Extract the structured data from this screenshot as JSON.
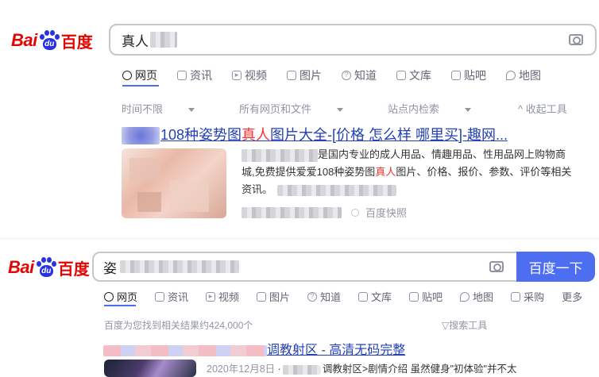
{
  "brand": {
    "bai": "Bai",
    "du": "du",
    "cn": "百度"
  },
  "result1": {
    "query_visible": "真人",
    "tabs": [
      {
        "label": "网页",
        "icon": "search-icon",
        "active": true
      },
      {
        "label": "资讯",
        "icon": "news-icon"
      },
      {
        "label": "视频",
        "icon": "video-icon"
      },
      {
        "label": "图片",
        "icon": "image-icon"
      },
      {
        "label": "知道",
        "icon": "question-icon"
      },
      {
        "label": "文库",
        "icon": "doc-icon"
      },
      {
        "label": "贴吧",
        "icon": "forum-icon"
      },
      {
        "label": "地图",
        "icon": "map-icon"
      }
    ],
    "tools": [
      "时间不限",
      "所有网页和文件",
      "站点内检索"
    ],
    "collapse_tools": "收起工具",
    "title_prefix": "108种姿势图",
    "title_em": "真人",
    "title_suffix": "图片大全-[价格 怎么样 哪里买]-趣网...",
    "abstract_l1": "是国内专业的成人用品、情趣用品、性用品网上购物商",
    "abstract_l2a": "城,免费提供爱爱108种姿势图",
    "abstract_l2em": "真人",
    "abstract_l2b": "图片、价格、报价、参数、评价等相关",
    "abstract_l3": "资讯。",
    "snapshot": "百度快照"
  },
  "result2": {
    "query_visible": "姿",
    "search_button": "百度一下",
    "tabs": [
      {
        "label": "网页",
        "icon": "search-icon",
        "active": true
      },
      {
        "label": "资讯",
        "icon": "news-icon"
      },
      {
        "label": "视频",
        "icon": "video-icon"
      },
      {
        "label": "图片",
        "icon": "image-icon"
      },
      {
        "label": "知道",
        "icon": "question-icon"
      },
      {
        "label": "文库",
        "icon": "doc-icon"
      },
      {
        "label": "贴吧",
        "icon": "forum-icon"
      },
      {
        "label": "地图",
        "icon": "map-icon"
      },
      {
        "label": "采购",
        "icon": "cart-icon"
      },
      {
        "label": "更多",
        "icon": ""
      }
    ],
    "result_count": "百度为您找到相关结果约424,000个",
    "search_tools": "搜索工具",
    "title_visible": "调教射区 - 高清无码完整",
    "date": "2020年12月8日",
    "snippet": "调教射区>剧情介绍 虽然健身\"初体验\"并不太"
  },
  "colors": {
    "brand_red": "#e10601",
    "brand_blue": "#2932e1",
    "link": "#2440b3",
    "highlight": "#f73131",
    "button": "#4e6ef2"
  }
}
